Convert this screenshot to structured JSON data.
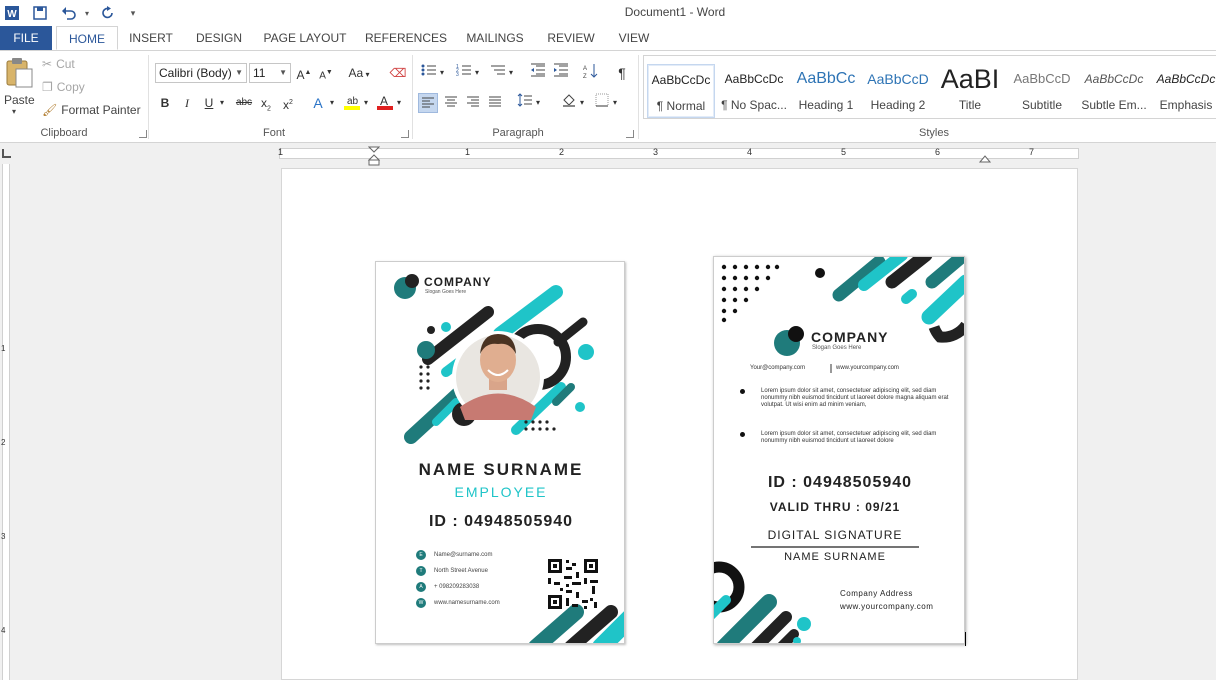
{
  "app": {
    "title": "Document1 - Word",
    "accent": "#2b579a"
  },
  "quick_access": {
    "word_icon": "word-icon",
    "save_icon": "save-icon",
    "undo_icon": "undo-icon",
    "redo_icon": "redo-icon",
    "customize_icon": "customize-icon"
  },
  "tabs": [
    "FILE",
    "HOME",
    "INSERT",
    "DESIGN",
    "PAGE LAYOUT",
    "REFERENCES",
    "MAILINGS",
    "REVIEW",
    "VIEW"
  ],
  "active_tab": "HOME",
  "clipboard": {
    "paste": "Paste",
    "cut": "Cut",
    "copy": "Copy",
    "format_painter": "Format Painter",
    "label": "Clipboard"
  },
  "font": {
    "family": "Calibri (Body)",
    "size": "11",
    "case_label": "Aa",
    "label": "Font"
  },
  "paragraph": {
    "label": "Paragraph",
    "pilcrow": "¶"
  },
  "styles": {
    "label": "Styles",
    "items": [
      {
        "sample": "AaBbCcDc",
        "name": "¶ Normal",
        "selected": true
      },
      {
        "sample": "AaBbCcDc",
        "name": "¶ No Spac..."
      },
      {
        "sample": "AaBbCc",
        "name": "Heading 1"
      },
      {
        "sample": "AaBbCcD",
        "name": "Heading 2"
      },
      {
        "sample": "AaBI",
        "name": "Title"
      },
      {
        "sample": "AaBbCcD",
        "name": "Subtitle"
      },
      {
        "sample": "AaBbCcDc",
        "name": "Subtle Em..."
      },
      {
        "sample": "AaBbCcDc",
        "name": "Emphasis"
      }
    ]
  },
  "ruler": {
    "numbers": [
      "1",
      "1",
      "2",
      "3",
      "4",
      "5",
      "6",
      "7"
    ],
    "vnumbers": [
      "1",
      "2",
      "3",
      "4"
    ]
  },
  "card1": {
    "company": "COMPANY",
    "slogan": "Slogan Goes Here",
    "name": "NAME SURNAME",
    "role": "EMPLOYEE",
    "id": "ID : 04948505940",
    "contacts": [
      {
        "letter": "E",
        "text": "Name@surname.com"
      },
      {
        "letter": "T",
        "text": "North Street Avenue"
      },
      {
        "letter": "A",
        "text": "+ 098209283038"
      },
      {
        "letter": "W",
        "text": "www.namesurname.com"
      }
    ],
    "teal": "#1fc4c8",
    "dark_teal": "#1f7b7b"
  },
  "card2": {
    "company": "COMPANY",
    "slogan": "Slogan Goes Here",
    "email": "Your@company.com",
    "website": "www.yourcompany.com",
    "para1": "Lorem ipsum dolor sit amet, consectetuer adipiscing elit, sed diam nonummy nibh euismod tincidunt ut laoreet dolore magna aliquam erat volutpat. Ut wisi enim ad minim veniam,",
    "para2": "Lorem ipsum dolor sit amet, consectetuer adipiscing elit, sed diam nonummy nibh euismod tincidunt ut laoreet dolore",
    "id": "ID : 04948505940",
    "valid": "VALID THRU : 09/21",
    "signature": "DIGITAL SIGNATURE",
    "name": "NAME SURNAME",
    "address": "Company Address",
    "website2": "www.yourcompany.com"
  }
}
